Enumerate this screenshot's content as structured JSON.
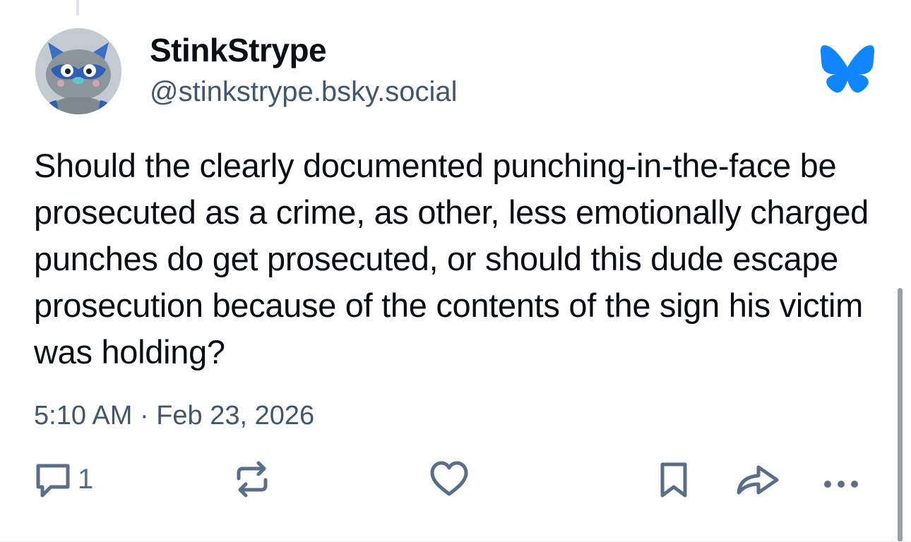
{
  "post": {
    "author": {
      "display_name": "StinkStrype",
      "handle": "@stinkstrype.bsky.social",
      "avatar_icon": "gray-raccoon-cartoon-avatar"
    },
    "text": "Should the clearly documented punching-in-the-face be prosecuted as a crime, as other, less emotionally charged punches do get prosecuted, or should this dude escape prosecution because of the contents of the sign his victim was holding?",
    "timestamp": "5:10 AM · Feb 23, 2026",
    "actions": {
      "reply_count": "1"
    }
  },
  "icons": {
    "brand": "bluesky-butterfly-icon",
    "reply": "speech-bubble-icon",
    "repost": "repost-arrows-icon",
    "like": "heart-icon",
    "bookmark": "bookmark-icon",
    "share": "share-arrow-icon",
    "more": "more-dots-icon"
  },
  "colors": {
    "brand_blue": "#1185fe",
    "text_primary": "#0b0f14",
    "text_secondary": "#42576c",
    "icon_gray": "#5a6f85"
  }
}
